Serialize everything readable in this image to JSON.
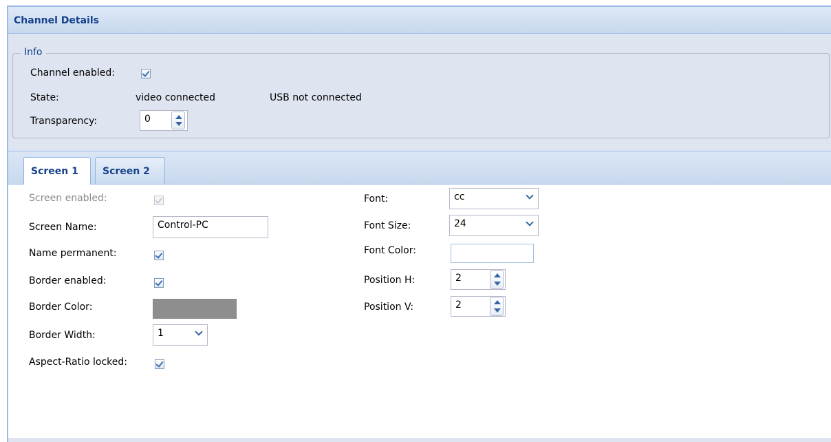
{
  "panel": {
    "title": "Channel Details"
  },
  "info": {
    "legend": "Info",
    "channel_enabled": {
      "label": "Channel enabled:",
      "checked": true
    },
    "state": {
      "label": "State:",
      "video": "video connected",
      "usb": "USB not connected"
    },
    "transparency": {
      "label": "Transparency:",
      "value": "0"
    }
  },
  "tabs": [
    {
      "label": "Screen 1",
      "active": true
    },
    {
      "label": "Screen 2",
      "active": false
    }
  ],
  "screen": {
    "screen_enabled": {
      "label": "Screen enabled:",
      "checked": true,
      "disabled": true
    },
    "screen_name": {
      "label": "Screen Name:",
      "value": "Control-PC"
    },
    "name_permanent": {
      "label": "Name permanent:",
      "checked": true
    },
    "border_enabled": {
      "label": "Border enabled:",
      "checked": true
    },
    "border_color": {
      "label": "Border Color:",
      "color": "#8e8e8e"
    },
    "border_width": {
      "label": "Border Width:",
      "value": "1"
    },
    "aspect_ratio_locked": {
      "label": "Aspect-Ratio locked:",
      "checked": true
    },
    "font": {
      "label": "Font:",
      "value": "cc"
    },
    "font_size": {
      "label": "Font Size:",
      "value": "24"
    },
    "font_color": {
      "label": "Font Color:",
      "value": ""
    },
    "position_h": {
      "label": "Position H:",
      "value": "2"
    },
    "position_v": {
      "label": "Position V:",
      "value": "2"
    }
  },
  "colors": {
    "accent": "#15428b",
    "header_bg": "#dfe8f6",
    "info_bg": "#dfe4f1"
  }
}
